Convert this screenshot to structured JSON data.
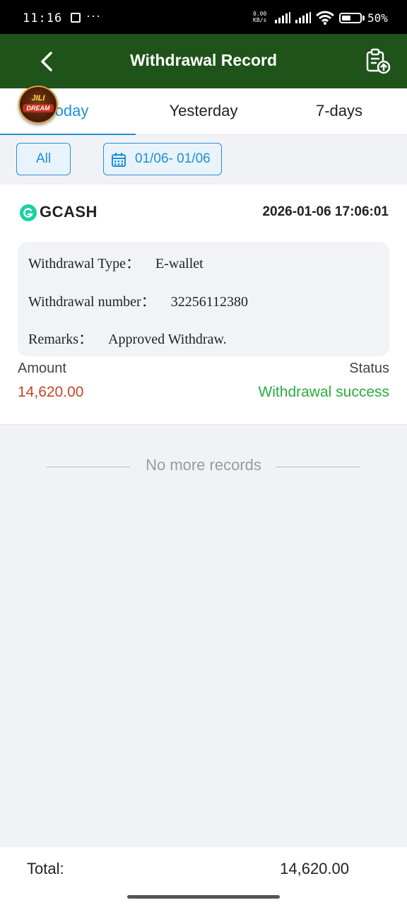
{
  "status_bar": {
    "time": "11:16",
    "more_indicator": "···",
    "net_speed_value": "0.00",
    "net_speed_unit": "KB/s",
    "battery_percent": "50%"
  },
  "header": {
    "title": "Withdrawal Record",
    "back_icon": "chevron-left-icon",
    "action_icon": "clipboard-upload-icon",
    "color": "#1f5319"
  },
  "tabs": [
    {
      "label": "Today",
      "active": true
    },
    {
      "label": "Yesterday",
      "active": false
    },
    {
      "label": "7-days",
      "active": false
    }
  ],
  "overlay_logo": {
    "line1": "JILI",
    "line2": "DREAM"
  },
  "filters": {
    "all_label": "All",
    "date_range": "01/06- 01/06",
    "date_icon": "calendar-icon"
  },
  "record": {
    "channel": "GCASH",
    "datetime": "2026-01-06 17:06:01",
    "details": [
      {
        "label": "Withdrawal Type：",
        "value": "E-wallet"
      },
      {
        "label": "Withdrawal number：",
        "value": "32256112380"
      },
      {
        "label": "Remarks：",
        "value": "Approved Withdraw."
      }
    ],
    "amount_label": "Amount",
    "amount_value": "14,620.00",
    "status_label": "Status",
    "status_value": "Withdrawal success",
    "colors": {
      "amount": "#c2472a",
      "status": "#2aae3f"
    }
  },
  "list_end_text": "No more records",
  "footer": {
    "total_label": "Total:",
    "total_value": "14,620.00"
  },
  "accent_color": "#1e8fd8"
}
